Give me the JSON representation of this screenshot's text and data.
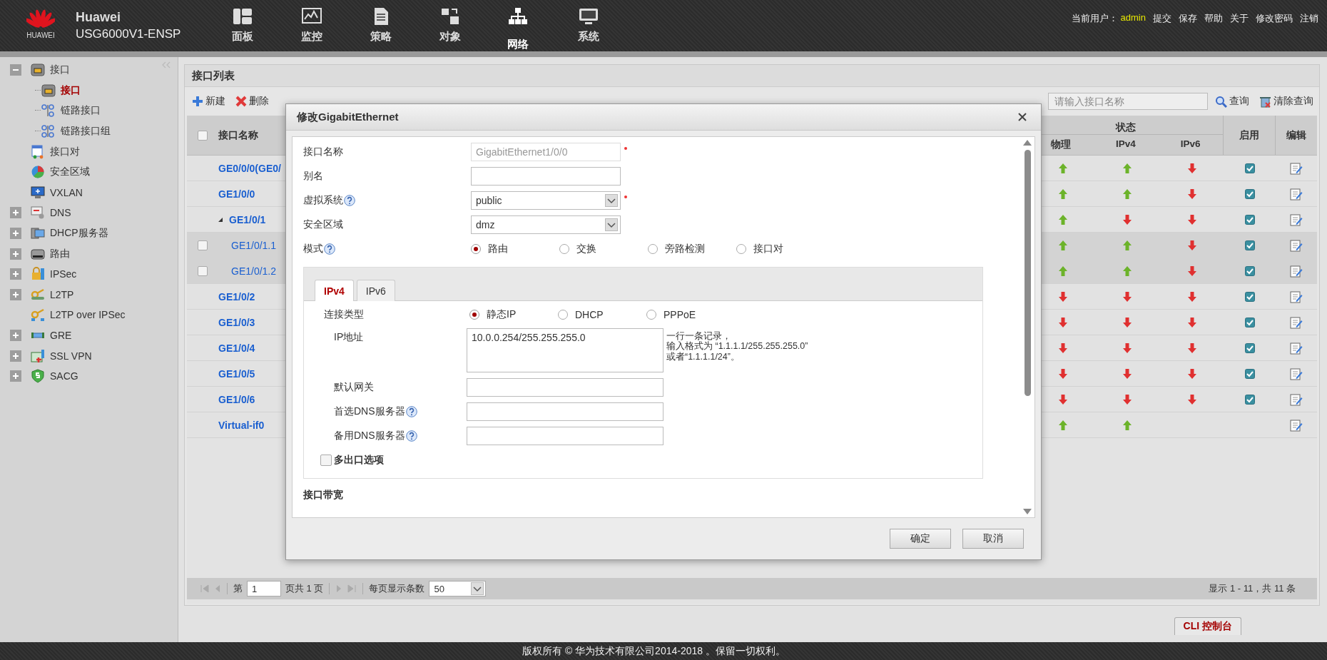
{
  "header": {
    "logo_text": "HUAWEI",
    "brand": "Huawei",
    "model": "USG6000V1-ENSP",
    "nav": [
      {
        "label": "面板",
        "kind": "dashboard",
        "selected": false
      },
      {
        "label": "监控",
        "kind": "monitor",
        "selected": false
      },
      {
        "label": "策略",
        "kind": "policy",
        "selected": false
      },
      {
        "label": "对象",
        "kind": "object",
        "selected": false
      },
      {
        "label": "网络",
        "kind": "network",
        "selected": true
      },
      {
        "label": "系统",
        "kind": "system",
        "selected": false
      }
    ],
    "user_label": "当前用户：",
    "user": "admin",
    "links": [
      "提交",
      "保存",
      "帮助",
      "关于",
      "修改密码",
      "注销"
    ]
  },
  "sidebar": {
    "items": [
      {
        "label": "接口",
        "kind": "port",
        "expanded": true,
        "selected": false,
        "children": [
          {
            "label": "接口",
            "kind": "port",
            "selected": true
          },
          {
            "label": "链路接口",
            "kind": "link",
            "selected": false
          },
          {
            "label": "链路接口组",
            "kind": "link-group",
            "selected": false
          }
        ]
      },
      {
        "label": "接口对",
        "kind": "pair",
        "selected": false
      },
      {
        "label": "安全区域",
        "kind": "zone",
        "selected": false
      },
      {
        "label": "VXLAN",
        "kind": "vxlan",
        "selected": false
      },
      {
        "label": "DNS",
        "kind": "dns",
        "expanded": false,
        "selected": false
      },
      {
        "label": "DHCP服务器",
        "kind": "dhcp",
        "expanded": false,
        "selected": false
      },
      {
        "label": "路由",
        "kind": "route",
        "expanded": false,
        "selected": false
      },
      {
        "label": "IPSec",
        "kind": "ipsec",
        "expanded": false,
        "selected": false
      },
      {
        "label": "L2TP",
        "kind": "key",
        "expanded": false,
        "selected": false
      },
      {
        "label": "L2TP over IPSec",
        "kind": "key-net",
        "selected": false
      },
      {
        "label": "GRE",
        "kind": "gre",
        "expanded": false,
        "selected": false
      },
      {
        "label": "SSL VPN",
        "kind": "ssl",
        "expanded": false,
        "selected": false
      },
      {
        "label": "SACG",
        "kind": "shield",
        "expanded": false,
        "selected": false
      }
    ]
  },
  "panel": {
    "title": "接口列表",
    "toolbar": [
      {
        "label": "新建",
        "kind": "add"
      },
      {
        "label": "删除",
        "kind": "delete"
      }
    ],
    "search": {
      "placeholder": "请输入接口名称"
    },
    "search_buttons": [
      {
        "label": "查询",
        "kind": "search"
      },
      {
        "label": "清除查询",
        "kind": "clear"
      }
    ],
    "table": {
      "select_all_checked": false,
      "columns": {
        "name": "接口名称",
        "status": "状态",
        "physical": "物理",
        "ipv4": "IPv4",
        "ipv6": "IPv6",
        "enabled": "启用",
        "edit": "编辑"
      },
      "rows": [
        {
          "name": "GE0/0/0(GE0/",
          "physical_up": true,
          "ipv4_up": true,
          "ipv6_up": false,
          "enabled": true
        },
        {
          "name": "GE1/0/0",
          "physical_up": true,
          "ipv4_up": true,
          "ipv6_up": false,
          "enabled": true
        },
        {
          "name": "GE1/0/1",
          "expanded": true,
          "physical_up": true,
          "ipv4_up": false,
          "ipv6_up": false,
          "enabled": true,
          "children": [
            {
              "name": "GE1/0/1.1",
              "checked": false,
              "physical_up": true,
              "ipv4_up": true,
              "ipv6_up": false,
              "enabled": true
            },
            {
              "name": "GE1/0/1.2",
              "checked": false,
              "physical_up": true,
              "ipv4_up": true,
              "ipv6_up": false,
              "enabled": true
            }
          ]
        },
        {
          "name": "GE1/0/2",
          "physical_up": false,
          "ipv4_up": false,
          "ipv6_up": false,
          "enabled": true
        },
        {
          "name": "GE1/0/3",
          "physical_up": false,
          "ipv4_up": false,
          "ipv6_up": false,
          "enabled": true
        },
        {
          "name": "GE1/0/4",
          "physical_up": false,
          "ipv4_up": false,
          "ipv6_up": false,
          "enabled": true
        },
        {
          "name": "GE1/0/5",
          "physical_up": false,
          "ipv4_up": false,
          "ipv6_up": false,
          "enabled": true
        },
        {
          "name": "GE1/0/6",
          "physical_up": false,
          "ipv4_up": false,
          "ipv6_up": false,
          "enabled": true
        },
        {
          "name": "Virtual-if0",
          "physical_up": true,
          "ipv4_up": true
        }
      ]
    },
    "pagination": {
      "page_label": "第",
      "page": "1",
      "total_label": "页共 1 页",
      "page_size_label": "每页显示条数",
      "page_size": "50",
      "summary": "显示 1 - 11，共 11 条"
    }
  },
  "cli_tab": "CLI 控制台",
  "footer": "版权所有 © 华为技术有限公司2014-2018 。保留一切权利。",
  "dialog": {
    "title": "修改GigabitEthernet",
    "fields": [
      {
        "kind": "text",
        "label": "接口名称",
        "value": "GigabitEthernet1/0/0",
        "disabled": true,
        "required": true
      },
      {
        "kind": "text",
        "label": "别名"
      },
      {
        "kind": "select",
        "label": "虚拟系统",
        "help": true,
        "value": "public",
        "required": true
      },
      {
        "kind": "select",
        "label": "安全区域",
        "value": "dmz"
      },
      {
        "kind": "radio",
        "label": "模式",
        "help": true,
        "options": [
          {
            "label": "路由",
            "selected": true
          },
          {
            "label": "交换",
            "selected": false
          },
          {
            "label": "旁路检测",
            "selected": false
          },
          {
            "label": "接口对",
            "selected": false
          }
        ]
      }
    ],
    "tabs": [
      {
        "label": "IPv4",
        "selected": true
      },
      {
        "label": "IPv6",
        "selected": false
      }
    ],
    "ipv4_fields": [
      {
        "kind": "radio",
        "label": "连接类型",
        "options": [
          {
            "label": "静态IP",
            "selected": true
          },
          {
            "label": "DHCP",
            "selected": false
          },
          {
            "label": "PPPoE",
            "selected": false
          }
        ]
      },
      {
        "kind": "textarea",
        "label": "IP地址",
        "value": "10.0.0.254/255.255.255.0",
        "hint": [
          "一行一条记录，",
          "输入格式为 “1.1.1.1/255.255.255.0”",
          "或者“1.1.1.1/24”。"
        ]
      },
      {
        "kind": "text",
        "label": "默认网关"
      },
      {
        "kind": "text",
        "label": "首选DNS服务器",
        "help": true
      },
      {
        "kind": "text",
        "label": "备用DNS服务器",
        "help": true
      }
    ],
    "multi_exit": {
      "label": "多出口选项",
      "checked": false
    },
    "section": "接口带宽",
    "buttons": [
      "确定",
      "取消"
    ]
  }
}
